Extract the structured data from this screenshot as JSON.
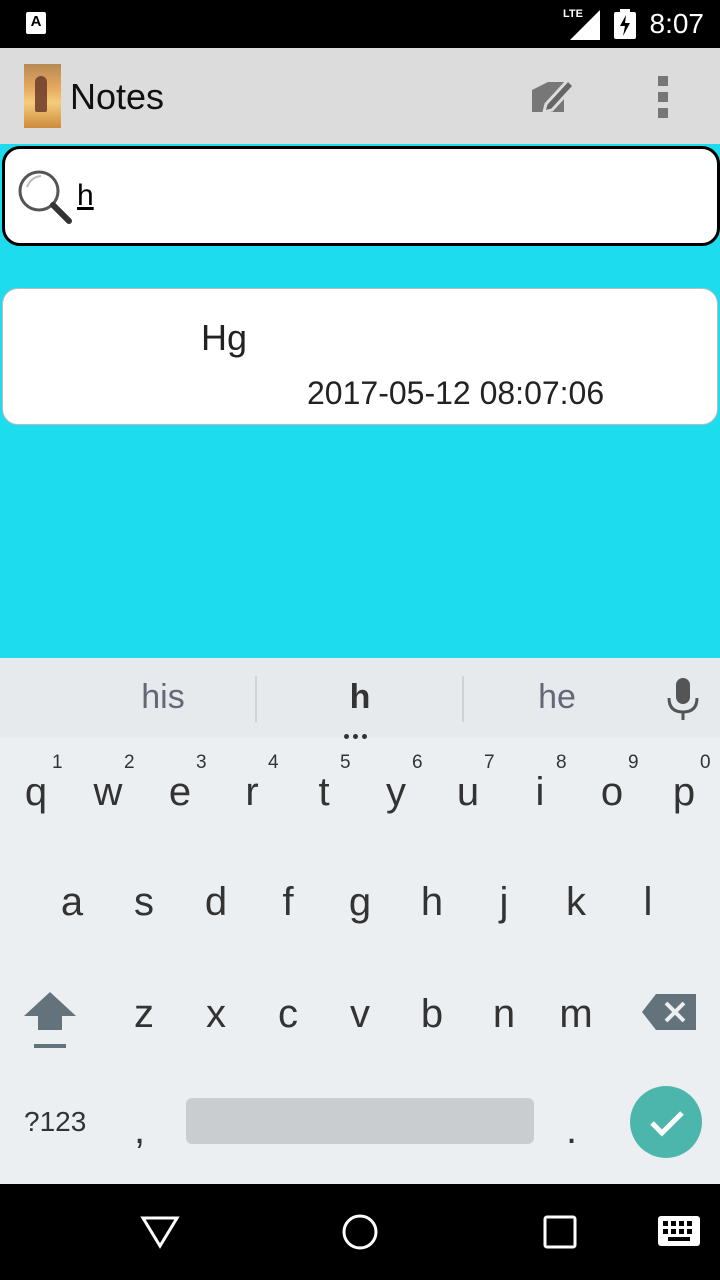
{
  "status_bar": {
    "time": "8:07",
    "network": "LTE",
    "notification_letter": "A"
  },
  "app_bar": {
    "title": "Notes",
    "compose_icon": "compose-icon",
    "overflow_icon": "more-vert-icon"
  },
  "search": {
    "value": "h",
    "icon": "search-icon"
  },
  "notes": [
    {
      "title": "Hg",
      "date": "2017-05-12 08:07:06"
    }
  ],
  "keyboard": {
    "suggestions": [
      "his",
      "h",
      "he"
    ],
    "row1": [
      {
        "key": "q",
        "hint": "1"
      },
      {
        "key": "w",
        "hint": "2"
      },
      {
        "key": "e",
        "hint": "3"
      },
      {
        "key": "r",
        "hint": "4"
      },
      {
        "key": "t",
        "hint": "5"
      },
      {
        "key": "y",
        "hint": "6"
      },
      {
        "key": "u",
        "hint": "7"
      },
      {
        "key": "i",
        "hint": "8"
      },
      {
        "key": "o",
        "hint": "9"
      },
      {
        "key": "p",
        "hint": "0"
      }
    ],
    "row2": [
      "a",
      "s",
      "d",
      "f",
      "g",
      "h",
      "j",
      "k",
      "l"
    ],
    "row3": [
      "z",
      "x",
      "c",
      "v",
      "b",
      "n",
      "m"
    ],
    "symbols_label": "?123",
    "comma": ",",
    "period": "."
  },
  "colors": {
    "background": "#1cdcee",
    "enter_key": "#4db6ac",
    "app_bar": "#dcdcdc"
  }
}
